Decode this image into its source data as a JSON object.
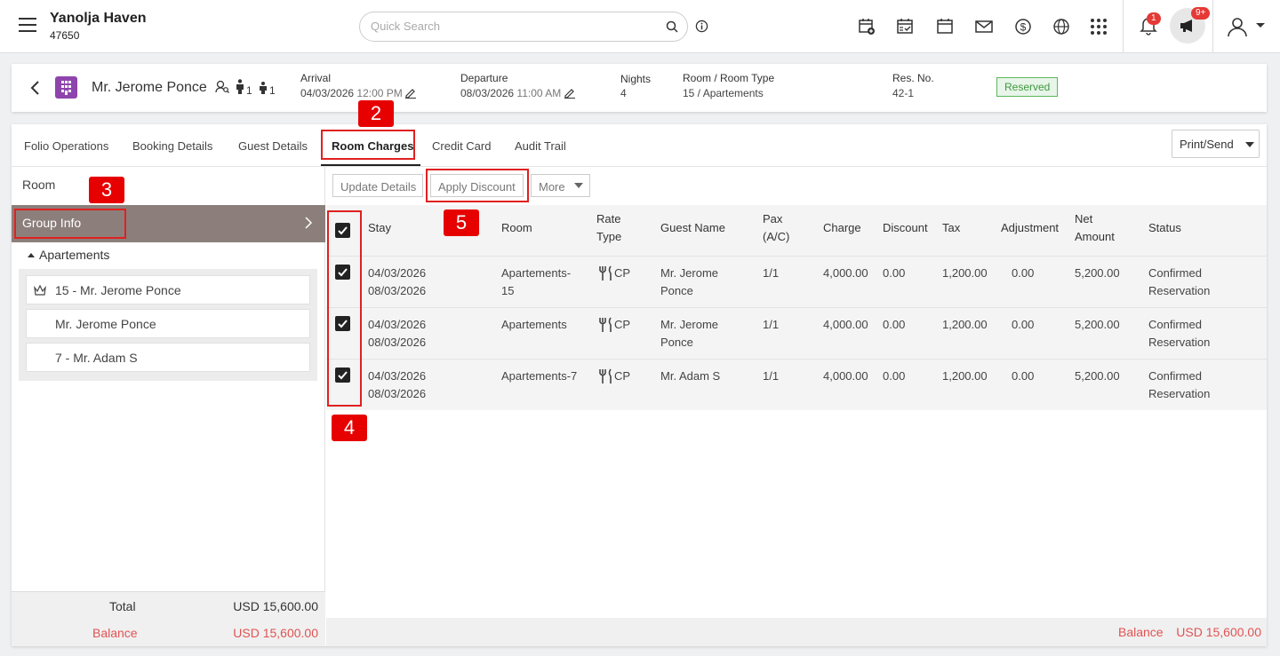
{
  "hotel": {
    "name": "Yanolja Haven",
    "code": "47650"
  },
  "search": {
    "placeholder": "Quick Search"
  },
  "notifications": {
    "bell_count": "1",
    "announce_count": "9+"
  },
  "reservation": {
    "guest_name": "Mr. Jerome Ponce",
    "adults": "1",
    "children": "1",
    "arrival_label": "Arrival",
    "arrival_date": "04/03/2026",
    "arrival_time": "12:00 PM",
    "departure_label": "Departure",
    "departure_date": "08/03/2026",
    "departure_time": "11:00 AM",
    "nights_label": "Nights",
    "nights": "4",
    "room_type_label": "Room / Room Type",
    "room_type": "15 / Apartements",
    "res_no_label": "Res. No.",
    "res_no": "42-1",
    "status": "Reserved"
  },
  "tabs": [
    "Folio Operations",
    "Booking Details",
    "Guest Details",
    "Room Charges",
    "Credit Card",
    "Audit Trail"
  ],
  "print_send": "Print/Send",
  "left_panel": {
    "room_label": "Room",
    "group_info": "Group Info",
    "group_name": "Apartements",
    "rooms": [
      "15 - Mr. Jerome Ponce",
      "Mr. Jerome Ponce",
      "7 - Mr. Adam S"
    ],
    "total_label": "Total",
    "total_value": "USD 15,600.00",
    "balance_label": "Balance",
    "balance_value": "USD 15,600.00"
  },
  "toolbar": {
    "update": "Update Details",
    "discount": "Apply Discount",
    "more": "More"
  },
  "table": {
    "headers": {
      "stay": "Stay",
      "room": "Room",
      "rate_type_1": "Rate",
      "rate_type_2": "Type",
      "guest": "Guest Name",
      "pax_1": "Pax",
      "pax_2": "(A/C)",
      "charge": "Charge",
      "discount": "Discount",
      "tax": "Tax",
      "adjustment": "Adjustment",
      "net_1": "Net",
      "net_2": "Amount",
      "status": "Status"
    },
    "rows": [
      {
        "from": "04/03/2026",
        "to": "08/03/2026",
        "room_1": "Apartements-",
        "room_2": "15",
        "rate": "CP",
        "guest_1": "Mr. Jerome",
        "guest_2": "Ponce",
        "pax": "1/1",
        "charge": "4,000.00",
        "discount": "0.00",
        "tax": "1,200.00",
        "adjustment": "0.00",
        "net": "5,200.00",
        "status_1": "Confirmed",
        "status_2": "Reservation"
      },
      {
        "from": "04/03/2026",
        "to": "08/03/2026",
        "room_1": "Apartements",
        "room_2": "",
        "rate": "CP",
        "guest_1": "Mr. Jerome",
        "guest_2": "Ponce",
        "pax": "1/1",
        "charge": "4,000.00",
        "discount": "0.00",
        "tax": "1,200.00",
        "adjustment": "0.00",
        "net": "5,200.00",
        "status_1": "Confirmed",
        "status_2": "Reservation"
      },
      {
        "from": "04/03/2026",
        "to": "08/03/2026",
        "room_1": "Apartements-7",
        "room_2": "",
        "rate": "CP",
        "guest_1": "Mr. Adam S",
        "guest_2": "",
        "pax": "1/1",
        "charge": "4,000.00",
        "discount": "0.00",
        "tax": "1,200.00",
        "adjustment": "0.00",
        "net": "5,200.00",
        "status_1": "Confirmed",
        "status_2": "Reservation"
      }
    ]
  },
  "footer": {
    "balance_label": "Balance",
    "balance_value": "USD 15,600.00"
  },
  "callouts": {
    "c2": "2",
    "c3": "3",
    "c4": "4",
    "c5": "5"
  }
}
